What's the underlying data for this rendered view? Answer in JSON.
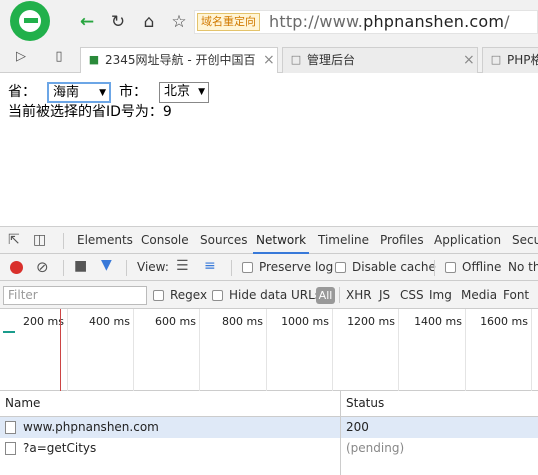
{
  "browser": {
    "badge": "域名重定向",
    "url_prefix": "http://www.",
    "url_domain": "phpnanshen.com",
    "url_suffix": "/",
    "tabs": [
      {
        "title": "2345网址导航 - 开创中国百",
        "close": "×"
      },
      {
        "title": "管理后台",
        "close": "×"
      },
      {
        "title": "PHP格"
      }
    ]
  },
  "page": {
    "province_label": "省：",
    "province_value": "海南",
    "city_label": "市：",
    "city_value": "北京",
    "result_text": "当前被选择的省ID号为：9"
  },
  "devtools": {
    "tabs": [
      "Elements",
      "Console",
      "Sources",
      "Network",
      "Timeline",
      "Profiles",
      "Application",
      "Secu"
    ],
    "active_tab": "Network",
    "view_label": "View:",
    "preserve_log": "Preserve log",
    "disable_cache": "Disable cache",
    "offline": "Offline",
    "no_throttle": "No th",
    "filter_placeholder": "Filter",
    "regex": "Regex",
    "hide_data_urls": "Hide data URLs",
    "all": "All",
    "types": [
      "XHR",
      "JS",
      "CSS",
      "Img",
      "Media",
      "Font"
    ],
    "ticks": [
      "200 ms",
      "400 ms",
      "600 ms",
      "800 ms",
      "1000 ms",
      "1200 ms",
      "1400 ms",
      "1600 ms"
    ],
    "columns": {
      "name": "Name",
      "status": "Status"
    },
    "rows": [
      {
        "name": "www.phpnanshen.com",
        "status": "200"
      },
      {
        "name": "?a=getCitys",
        "status": "(pending)"
      }
    ]
  }
}
